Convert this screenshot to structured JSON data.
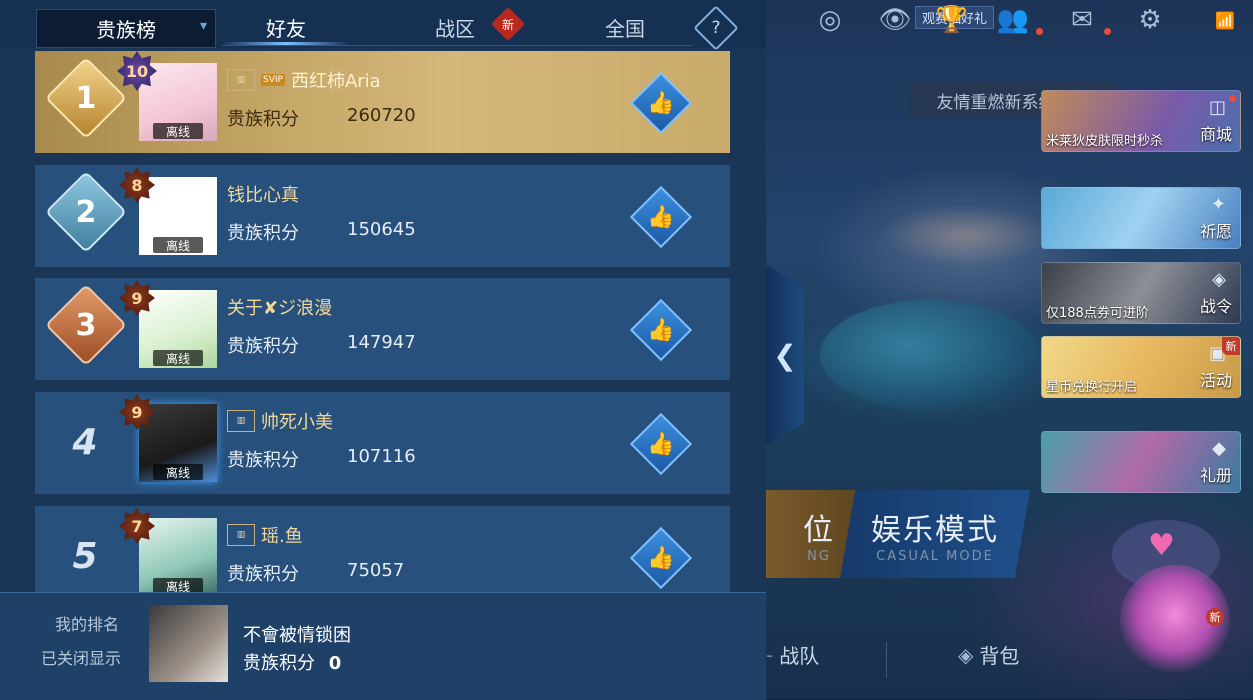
{
  "header": {
    "dropdown_label": "贵族榜",
    "tabs": [
      {
        "label": "好友",
        "active": true
      },
      {
        "label": "战区",
        "badge": "新"
      },
      {
        "label": "全国"
      }
    ],
    "help_label": "?"
  },
  "ranking": [
    {
      "rank": "1",
      "level": "10",
      "name": "西红柿Aria",
      "svip": "SVIP",
      "score_label": "贵族积分",
      "score": "260720",
      "status": "离线"
    },
    {
      "rank": "2",
      "level": "8",
      "name": "钱比心真",
      "score_label": "贵族积分",
      "score": "150645",
      "status": "离线"
    },
    {
      "rank": "3",
      "level": "9",
      "name": "关于✘ジ浪漫",
      "score_label": "贵族积分",
      "score": "147947",
      "status": "离线"
    },
    {
      "rank": "4",
      "level": "9",
      "name": "帅死小美",
      "score_label": "贵族积分",
      "score": "107116",
      "status": "离线"
    },
    {
      "rank": "5",
      "level": "7",
      "name": "瑶.鱼",
      "score_label": "贵族积分",
      "score": "75057",
      "status": "离线"
    }
  ],
  "footer": {
    "my_rank_label": "我的排名",
    "my_rank_status": "已关闭显示",
    "my_name": "不會被情锁困",
    "score_label": "贵族积分",
    "my_score": "0"
  },
  "game": {
    "banner_top": "观赛抽好礼",
    "toast": "友情重燃新系统上线",
    "side_cards": [
      {
        "caption": "米莱狄皮肤限时秒杀",
        "label": "商城"
      },
      {
        "caption": "",
        "label": "祈愿"
      },
      {
        "caption": "仅188点券可进阶",
        "label": "战令"
      },
      {
        "caption": "星币兑换行开启",
        "label": "活动",
        "badge": "新"
      },
      {
        "caption": "",
        "label": "礼册"
      }
    ],
    "mode_left": "位",
    "mode_left_sub": "NG",
    "mode_right": "娱乐模式",
    "mode_right_sub": "CASUAL MODE",
    "nav_team": "战队",
    "nav_bag": "背包",
    "pet_badge": "新"
  }
}
